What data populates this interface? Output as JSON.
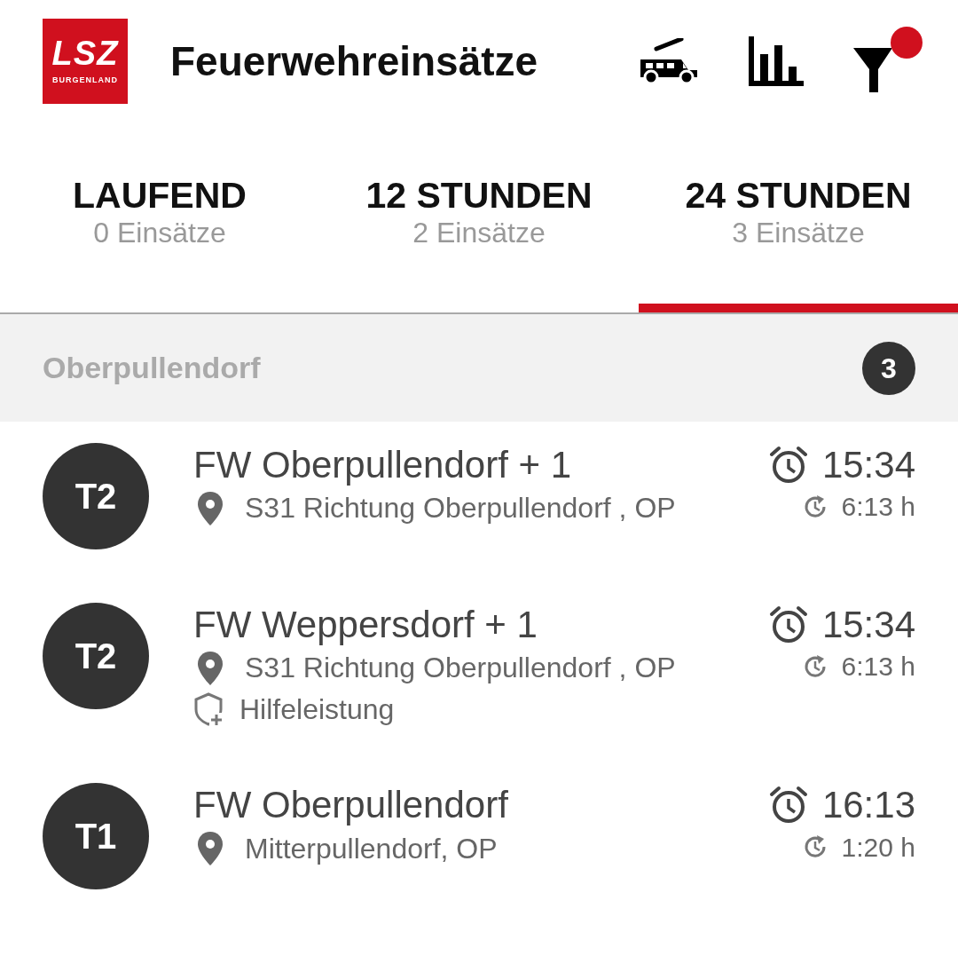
{
  "app_bar": {
    "logo": {
      "main": "LSZ",
      "sub": "BURGENLAND"
    },
    "title": "Feuerwehreinsätze",
    "filter_active": true
  },
  "tabs": [
    {
      "label": "LAUFEND",
      "count": "0 Einsätze",
      "selected": false
    },
    {
      "label": "12 STUNDEN",
      "count": "2 Einsätze",
      "selected": false
    },
    {
      "label": "24 STUNDEN",
      "count": "3 Einsätze",
      "selected": true
    }
  ],
  "groups": [
    {
      "name": "Oberpullendorf",
      "count": "3",
      "incidents": [
        {
          "level": "T2",
          "title": "FW Oberpullendorf + 1",
          "location": "S31 Richtung Oberpullendorf , OP",
          "time": "15:34",
          "duration": "6:13 h"
        },
        {
          "level": "T2",
          "title": "FW Weppersdorf + 1",
          "location": "S31 Richtung Oberpullendorf , OP",
          "type": "Hilfeleistung",
          "time": "15:34",
          "duration": "6:13 h"
        },
        {
          "level": "T1",
          "title": "FW Oberpullendorf",
          "location": "Mitterpullendorf, OP",
          "time": "16:13",
          "duration": "1:20 h"
        }
      ]
    }
  ]
}
